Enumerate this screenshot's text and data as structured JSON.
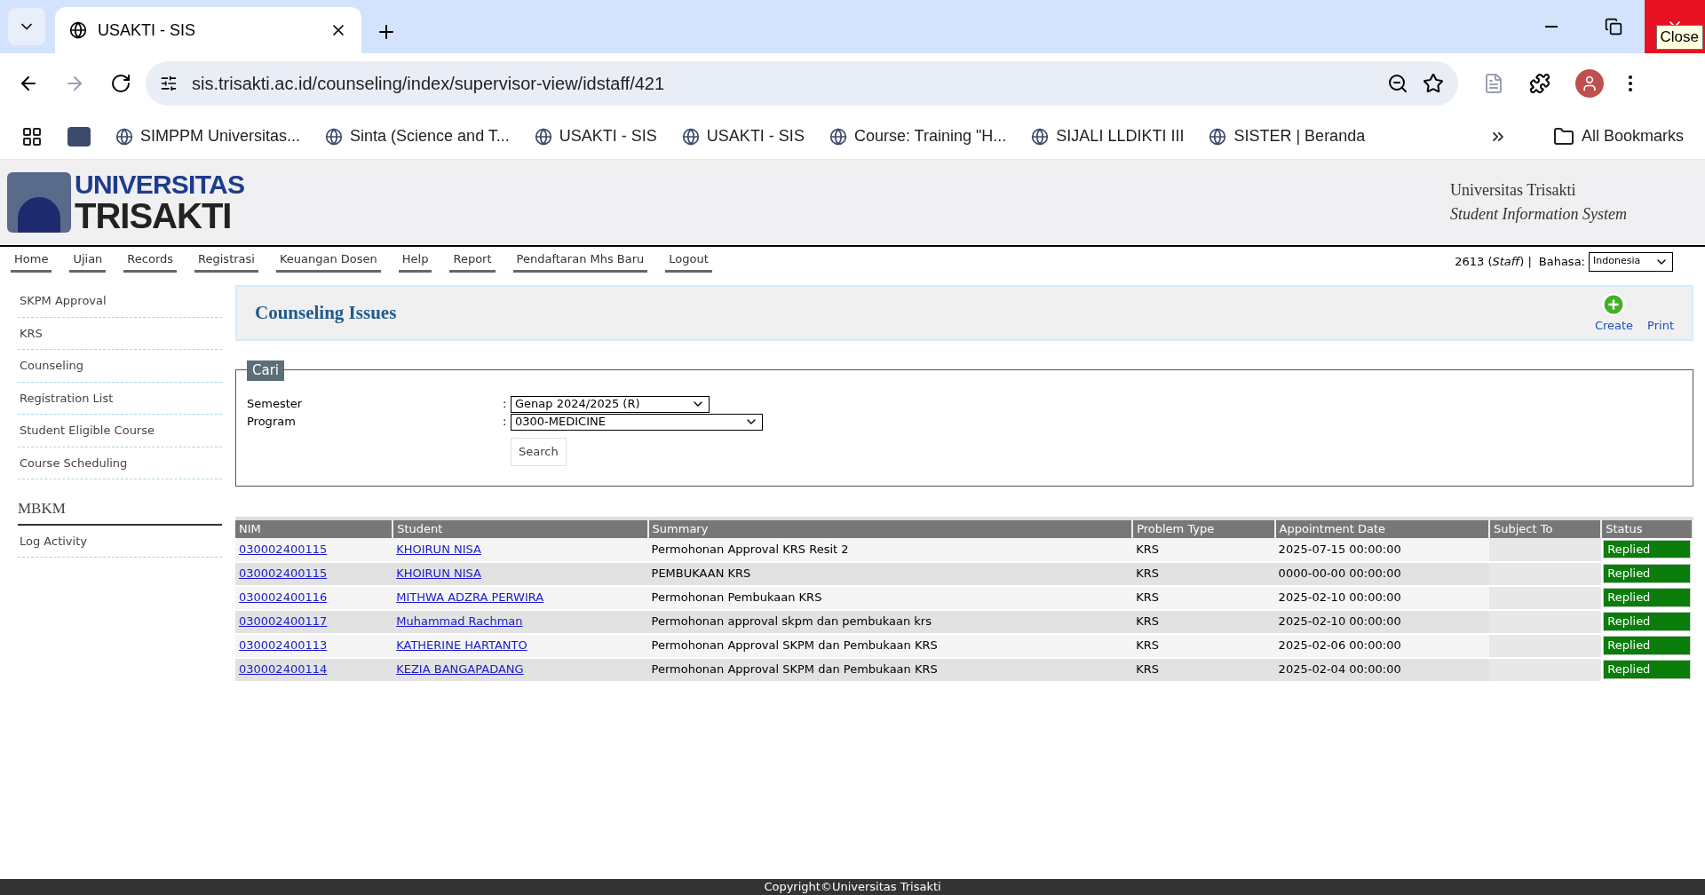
{
  "browser": {
    "tab_title": "USAKTI - SIS",
    "close_tooltip": "Close",
    "url": "sis.trisakti.ac.id/counseling/index/supervisor-view/idstaff/421",
    "bookmarks": [
      "SIMPPM Universitas...",
      "Sinta (Science and T...",
      "USAKTI - SIS",
      "USAKTI - SIS",
      "Course: Training \"H...",
      "SIJALI LLDIKTI III",
      "SISTER | Beranda"
    ],
    "all_bookmarks": "All Bookmarks"
  },
  "header": {
    "logo_top": "UNIVERSITAS",
    "logo_bottom": "TRISAKTI",
    "org": "Universitas Trisakti",
    "system": "Student Information System"
  },
  "nav": {
    "items": [
      "Home",
      "Ujian",
      "Records",
      "Registrasi",
      "Keuangan Dosen",
      "Help",
      "Report",
      "Pendaftaran Mhs Baru",
      "Logout"
    ],
    "user": "2613 (*Staff*) |",
    "language_label": "Bahasa:",
    "language": "Indonesia"
  },
  "sidebar": {
    "items": [
      "SKPM Approval",
      "KRS",
      "Counseling",
      "Registration List",
      "Student Eligible Course",
      "Course Scheduling"
    ],
    "section": "MBKM",
    "section_items": [
      "Log Activity"
    ]
  },
  "page": {
    "title": "Counseling Issues",
    "actions": [
      {
        "kind": "create",
        "label": "Create"
      },
      {
        "kind": "print",
        "label": "Print"
      }
    ]
  },
  "search_form": {
    "legend": "Cari",
    "fields": [
      {
        "label": "Semester",
        "value": "Genap 2024/2025 (R)"
      },
      {
        "label": "Program",
        "value": "0300-MEDICINE"
      }
    ],
    "colon": ":",
    "button": "Search"
  },
  "table": {
    "columns": [
      "NIM",
      "Student",
      "Summary",
      "Problem Type",
      "Appointment Date",
      "Subject To",
      "Status"
    ],
    "rows": [
      {
        "nim": "030002400115",
        "student": "KHOIRUN NISA",
        "summary": "Permohonan Approval KRS Resit 2",
        "problem_type": "KRS",
        "date": "2025-07-15 00:00:00",
        "status": "Replied"
      },
      {
        "nim": "030002400115",
        "student": "KHOIRUN NISA",
        "summary": "PEMBUKAAN KRS",
        "problem_type": "KRS",
        "date": "0000-00-00 00:00:00",
        "status": "Replied"
      },
      {
        "nim": "030002400116",
        "student": "MITHWA ADZRA PERWIRA",
        "summary": "Permohonan Pembukaan KRS",
        "problem_type": "KRS",
        "date": "2025-02-10 00:00:00",
        "status": "Replied"
      },
      {
        "nim": "030002400117",
        "student": "Muhammad Rachman",
        "summary": "Permohonan approval skpm dan pembukaan krs",
        "problem_type": "KRS",
        "date": "2025-02-10 00:00:00",
        "status": "Replied"
      },
      {
        "nim": "030002400113",
        "student": "KATHERINE HARTANTO",
        "summary": "Permohonan Approval SKPM dan Pembukaan KRS",
        "problem_type": "KRS",
        "date": "2025-02-06 00:00:00",
        "status": "Replied"
      },
      {
        "nim": "030002400114",
        "student": "KEZIA BANGAPADANG",
        "summary": "Permohonan Approval SKPM dan Pembukaan KRS",
        "problem_type": "KRS",
        "date": "2025-02-04 00:00:00",
        "status": "Replied"
      }
    ]
  },
  "footer": "Copyright©Universitas Trisakti"
}
